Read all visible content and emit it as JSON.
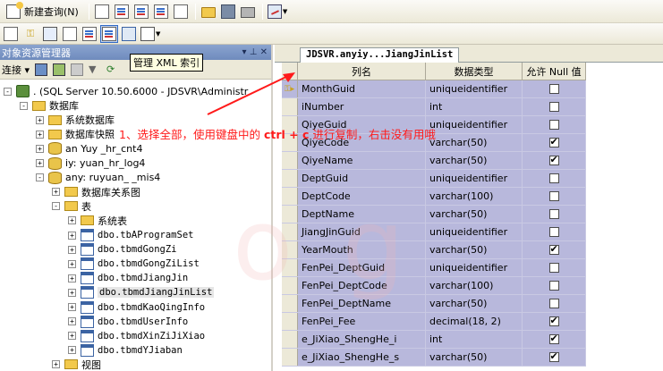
{
  "toolbar": {
    "new_query_label": "新建查询(N)",
    "tooltip": "管理 XML 索引"
  },
  "explorer": {
    "title": "对象资源管理器",
    "pin": "▾ ⊥ ✕",
    "connect_label": "连接 ▾",
    "items": [
      {
        "label": ". (SQL Server 10.50.6000 - JDSVR\\Administr",
        "icon": "server-icon",
        "expander": "-"
      },
      {
        "label": "数据库",
        "icon": "folder-icon",
        "expander": "-"
      },
      {
        "label": "系统数据库",
        "icon": "folder-icon",
        "expander": "+"
      },
      {
        "label": "数据库快照",
        "icon": "folder-icon",
        "expander": "+"
      },
      {
        "label": "an    Yuy    _hr_cnt4",
        "icon": "database-icon",
        "expander": "+"
      },
      {
        "label": "  iy:  yuan_hr_log4",
        "icon": "database-icon",
        "expander": "+"
      },
      {
        "label": "any:  ruyuan_ _mis4",
        "icon": "database-icon",
        "expander": "-"
      },
      {
        "label": "数据库关系图",
        "icon": "folder-icon",
        "expander": "+"
      },
      {
        "label": "表",
        "icon": "folder-icon",
        "expander": "-"
      },
      {
        "label": "系统表",
        "icon": "folder-icon",
        "expander": "+"
      },
      {
        "label": "dbo.tbAProgramSet",
        "icon": "table-icon",
        "expander": "+"
      },
      {
        "label": "dbo.tbmdGongZi",
        "icon": "table-icon",
        "expander": "+"
      },
      {
        "label": "dbo.tbmdGongZiList",
        "icon": "table-icon",
        "expander": "+"
      },
      {
        "label": "dbo.tbmdJiangJin",
        "icon": "table-icon",
        "expander": "+"
      },
      {
        "label": "dbo.tbmdJiangJinList",
        "icon": "table-icon",
        "expander": "+",
        "selected": true
      },
      {
        "label": "dbo.tbmdKaoQingInfo",
        "icon": "table-icon",
        "expander": "+"
      },
      {
        "label": "dbo.tbmdUserInfo",
        "icon": "table-icon",
        "expander": "+"
      },
      {
        "label": "dbo.tbmdXinZiJiXiao",
        "icon": "table-icon",
        "expander": "+"
      },
      {
        "label": "dbo.tbmdYJiaban",
        "icon": "table-icon",
        "expander": "+"
      },
      {
        "label": "视图",
        "icon": "folder-icon",
        "expander": "+"
      }
    ]
  },
  "document": {
    "tab_title": "JDSVR.anyiy...JiangJinList",
    "headers": {
      "col_name": "列名",
      "data_type": "数据类型",
      "allow_null": "允许 Null 值"
    },
    "rows": [
      {
        "name": "MonthGuid",
        "type": "uniqueidentifier",
        "null": false,
        "key": true
      },
      {
        "name": "iNumber",
        "type": "int",
        "null": false
      },
      {
        "name": "QiyeGuid",
        "type": "uniqueidentifier",
        "null": false
      },
      {
        "name": "QiyeCode",
        "type": "varchar(50)",
        "null": true
      },
      {
        "name": "QiyeName",
        "type": "varchar(50)",
        "null": true
      },
      {
        "name": "DeptGuid",
        "type": "uniqueidentifier",
        "null": false
      },
      {
        "name": "DeptCode",
        "type": "varchar(100)",
        "null": false
      },
      {
        "name": "DeptName",
        "type": "varchar(50)",
        "null": false
      },
      {
        "name": "JiangJinGuid",
        "type": "uniqueidentifier",
        "null": false
      },
      {
        "name": "YearMouth",
        "type": "varchar(50)",
        "null": true
      },
      {
        "name": "FenPei_DeptGuid",
        "type": "uniqueidentifier",
        "null": false
      },
      {
        "name": "FenPei_DeptCode",
        "type": "varchar(100)",
        "null": false
      },
      {
        "name": "FenPei_DeptName",
        "type": "varchar(50)",
        "null": false
      },
      {
        "name": "FenPei_Fee",
        "type": "decimal(18, 2)",
        "null": true
      },
      {
        "name": "e_JiXiao_ShengHe_i",
        "type": "int",
        "null": true
      },
      {
        "name": "e_JiXiao_ShengHe_s",
        "type": "varchar(50)",
        "null": true
      }
    ]
  },
  "annotation": {
    "part1": "1、选择全部，使用键盘中的 ",
    "keys": "ctrl + c",
    "part2": " 进行复制，右击没有用哦"
  },
  "colors": {
    "annotation": "#ff1a1a",
    "grid_selected": "#b8b8dc"
  }
}
